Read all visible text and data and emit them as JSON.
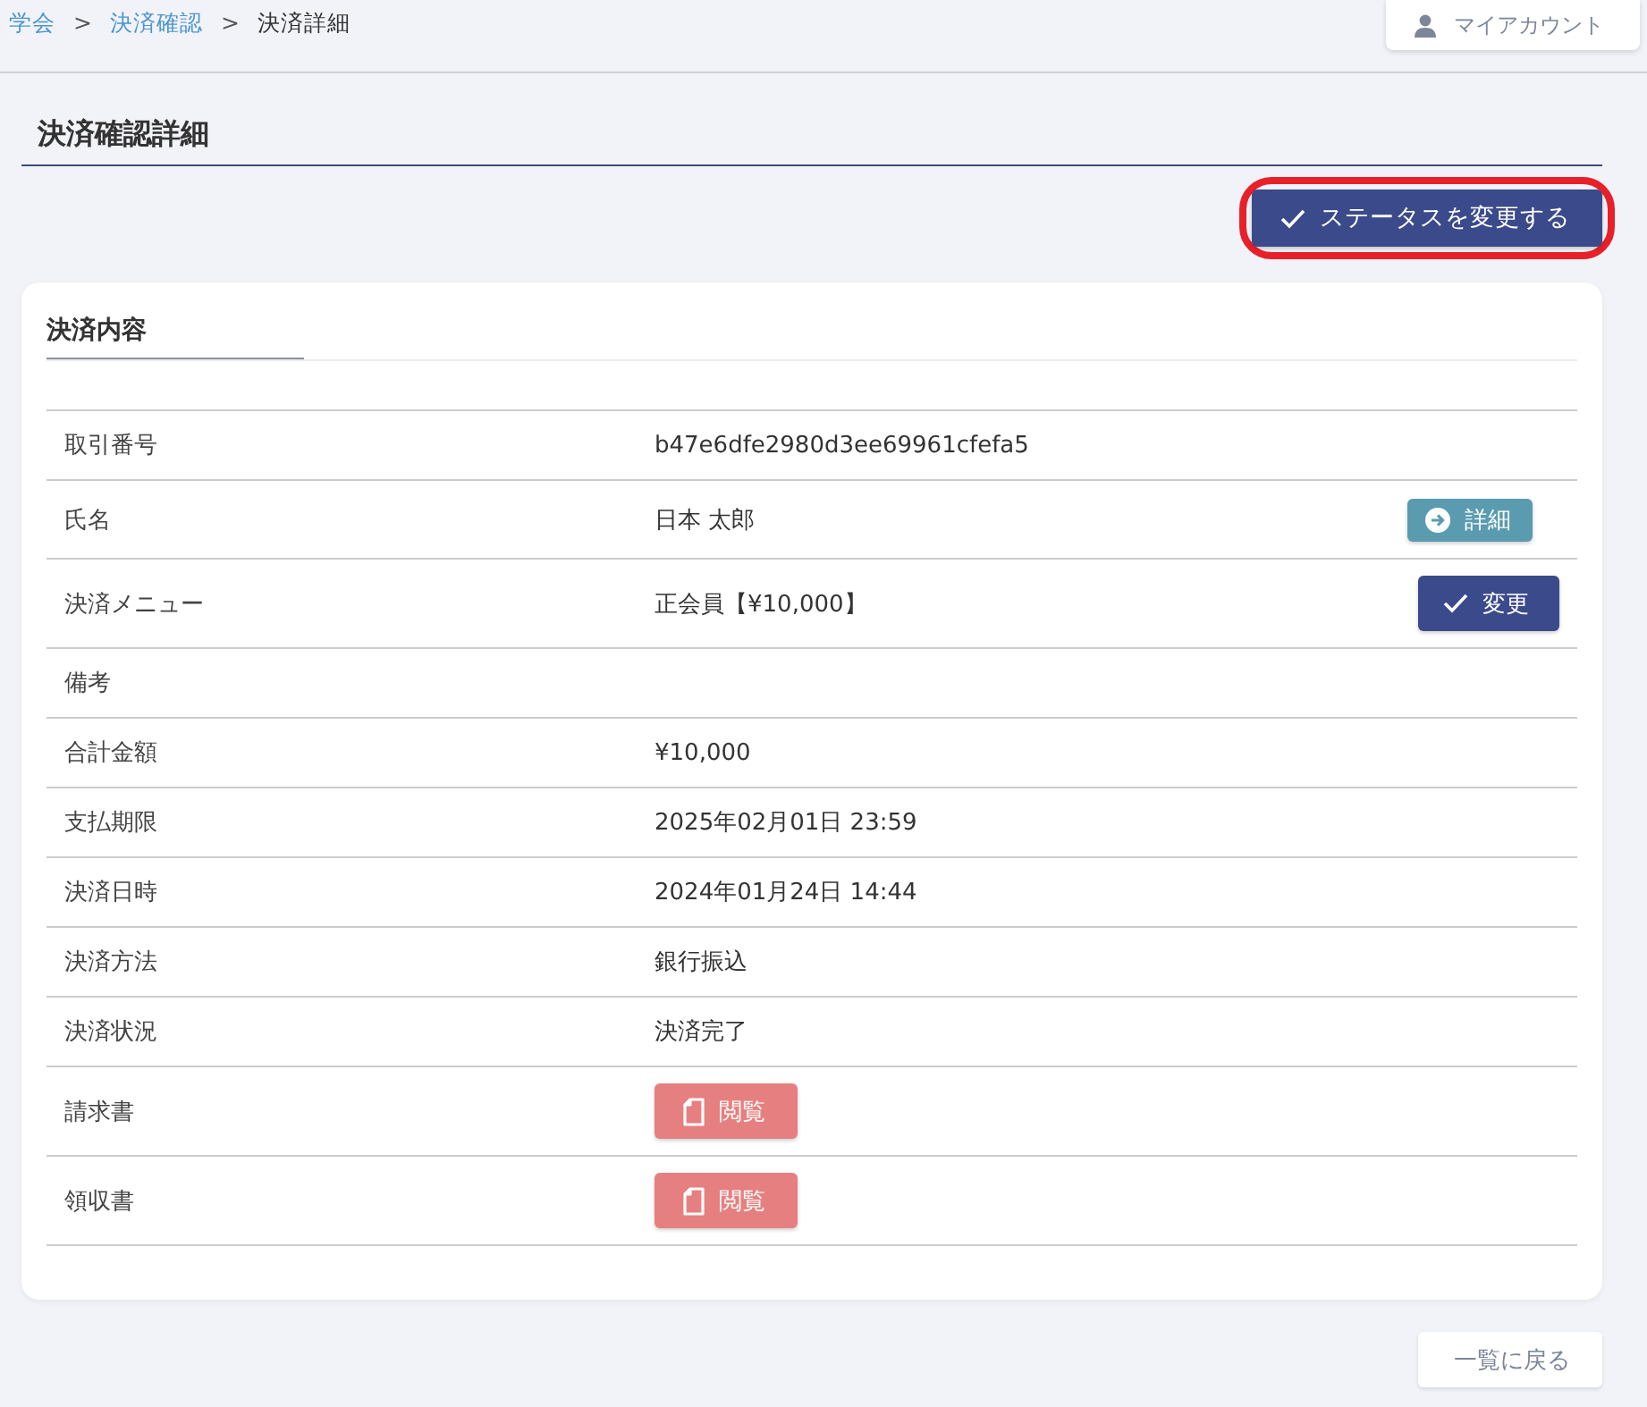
{
  "breadcrumb": [
    {
      "label": "学会",
      "link": true
    },
    {
      "label": "決済確認",
      "link": true
    },
    {
      "label": "決済詳細",
      "link": false
    }
  ],
  "breadcrumb_separator": ">",
  "account_button": {
    "label": "マイアカウント"
  },
  "page_title": "決済確認詳細",
  "status_button": {
    "label": "ステータスを変更する",
    "highlighted": true
  },
  "card": {
    "title": "決済内容",
    "rows": [
      {
        "label": "取引番号",
        "value": "b47e6dfe2980d3ee69961cfefa5"
      },
      {
        "label": "氏名",
        "value": "日本 太郎",
        "action": {
          "kind": "detail",
          "label": "詳細"
        }
      },
      {
        "label": "決済メニュー",
        "value": "正会員【¥10,000】",
        "action": {
          "kind": "change",
          "label": "変更"
        }
      },
      {
        "label": "備考"
      },
      {
        "label": "合計金額",
        "value": "¥10,000"
      },
      {
        "label": "支払期限",
        "value": "2025年02月01日 23:59"
      },
      {
        "label": "決済日時",
        "value": "2024年01月24日 14:44"
      },
      {
        "label": "決済方法",
        "value": "銀行振込"
      },
      {
        "label": "決済状況",
        "value": "決済完了"
      },
      {
        "label": "請求書",
        "action": {
          "kind": "view",
          "label": "閲覧"
        }
      },
      {
        "label": "領収書",
        "action": {
          "kind": "view",
          "label": "閲覧"
        }
      }
    ]
  },
  "back_button": {
    "label": "一覧に戻る"
  }
}
